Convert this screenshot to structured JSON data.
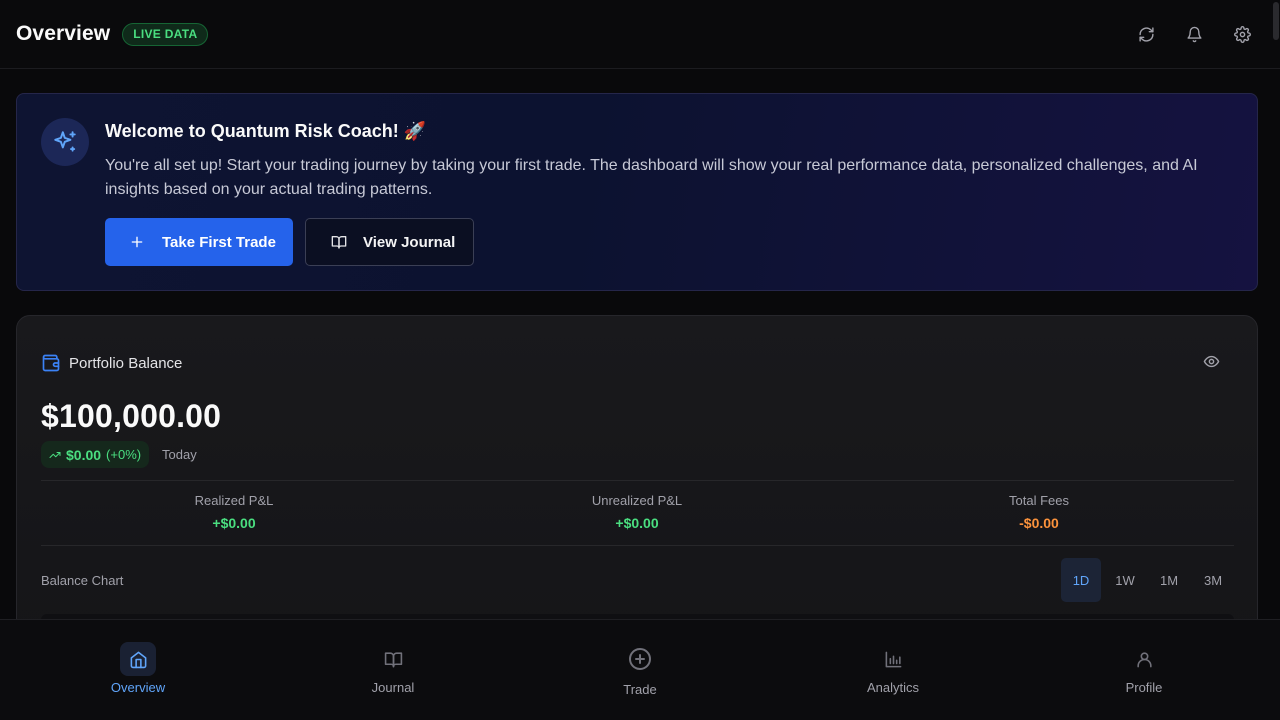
{
  "header": {
    "title": "Overview",
    "badge": "LIVE DATA",
    "actions": [
      {
        "name": "refresh-icon"
      },
      {
        "name": "bell-icon"
      },
      {
        "name": "gear-icon"
      }
    ]
  },
  "welcome": {
    "title": "Welcome to Quantum Risk Coach! 🚀",
    "text": "You're all set up! Start your trading journey by taking your first trade. The dashboard will show your real performance data, personalized challenges, and AI insights based on your actual trading patterns.",
    "primary_button": "Take First Trade",
    "secondary_button": "View Journal",
    "icon": "sparkles-icon"
  },
  "portfolio": {
    "title": "Portfolio Balance",
    "balance": "$100,000.00",
    "change": "$0.00",
    "change_pct": "(+0%)",
    "period": "Today",
    "stats": [
      {
        "label": "Realized P&L",
        "value": "+$0.00"
      },
      {
        "label": "Unrealized P&L",
        "value": "+$0.00"
      },
      {
        "label": "Total Fees",
        "value": "-$0.00"
      }
    ],
    "chart_label": "Balance Chart",
    "ranges": [
      "1D",
      "1W",
      "1M",
      "3M"
    ],
    "active_range": "1D"
  },
  "nav": {
    "items": [
      {
        "label": "Overview",
        "icon": "home-icon",
        "active": true
      },
      {
        "label": "Journal",
        "icon": "book-icon",
        "active": false
      },
      {
        "label": "Trade",
        "icon": "plus-circle-icon",
        "active": false
      },
      {
        "label": "Analytics",
        "icon": "bar-chart-icon",
        "active": false
      },
      {
        "label": "Profile",
        "icon": "user-icon",
        "active": false
      }
    ]
  },
  "colors": {
    "accent": "#2563eb",
    "positive": "#4ade80",
    "fees": "#fb923c",
    "background": "#09090b"
  }
}
